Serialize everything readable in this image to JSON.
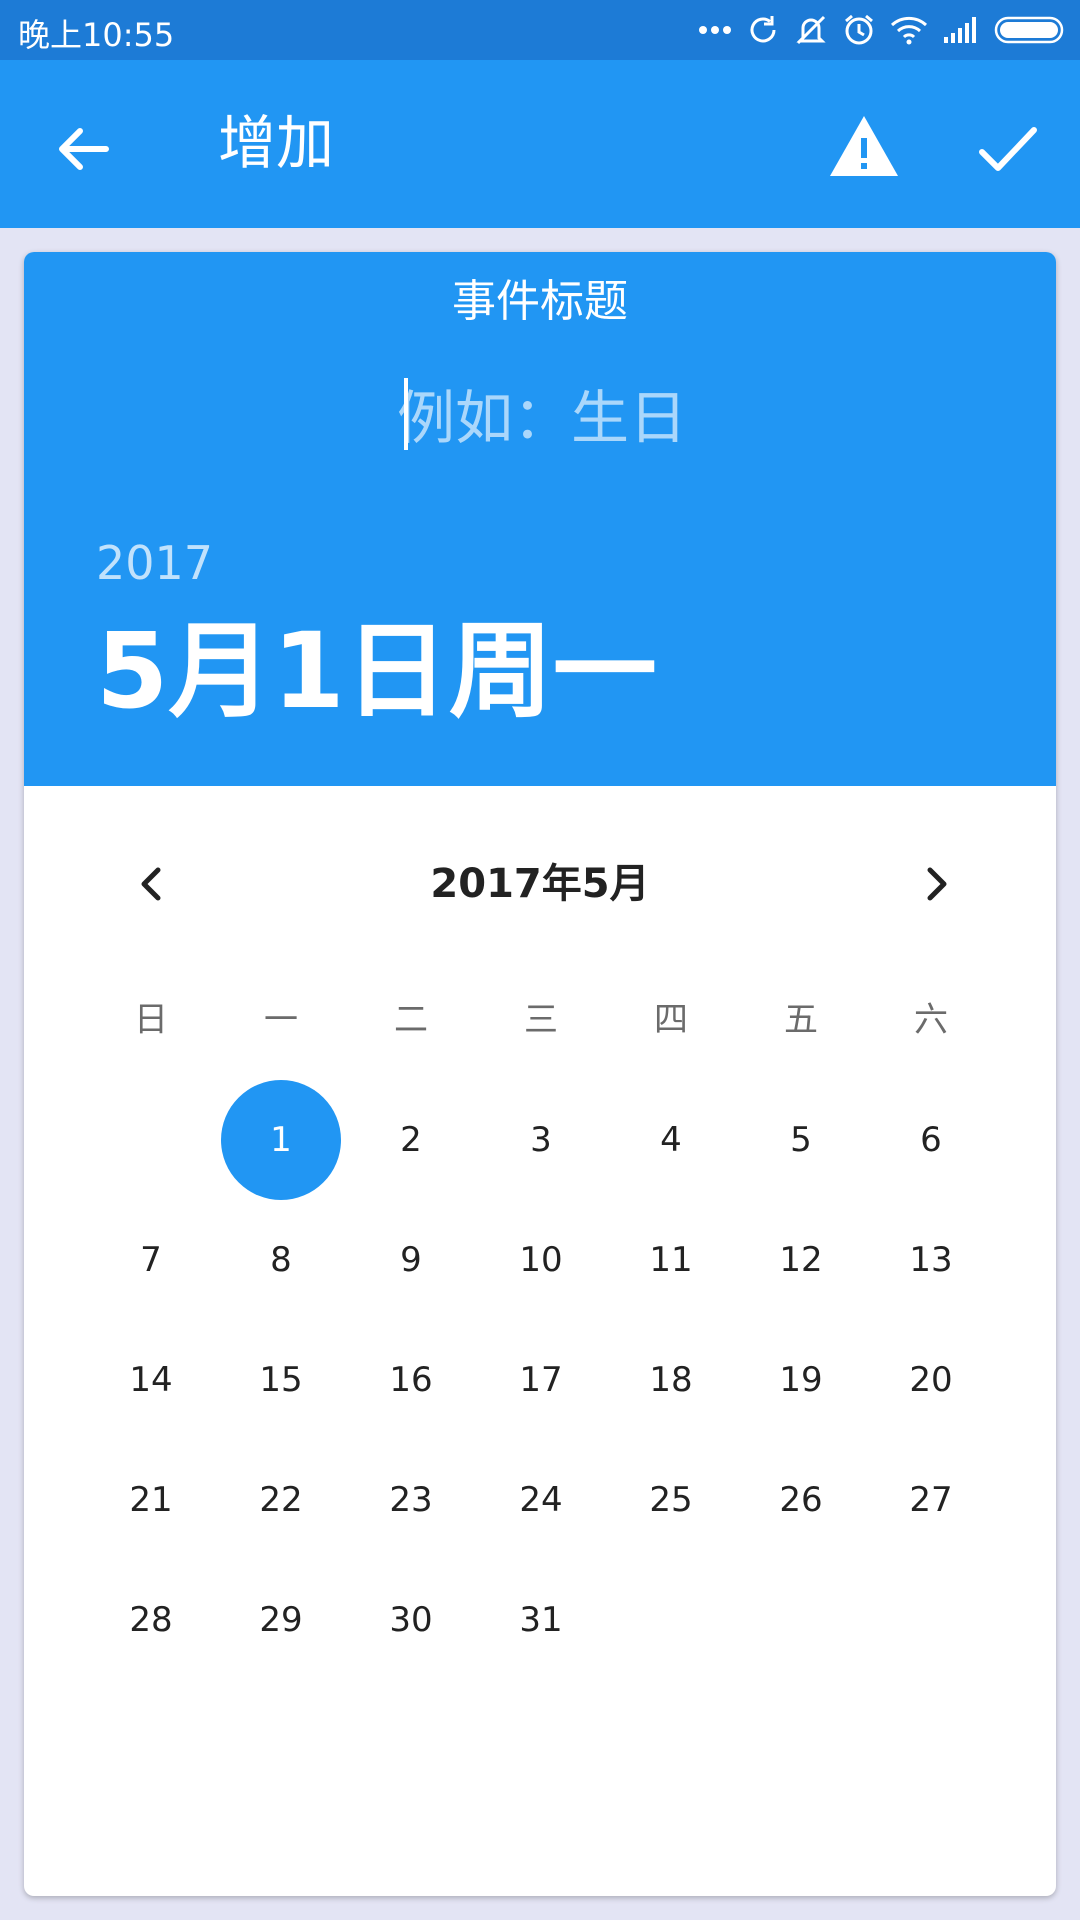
{
  "status_bar": {
    "time": "晚上10:55",
    "icons": [
      "more-dots-icon",
      "sync-icon",
      "silent-icon",
      "alarm-icon",
      "wifi-icon",
      "signal-icon",
      "battery-icon"
    ]
  },
  "app_bar": {
    "title": "增加",
    "back_icon": "arrow-left-icon",
    "warning_icon": "warning-icon",
    "confirm_icon": "check-icon"
  },
  "event": {
    "label": "事件标题",
    "placeholder": "例如：生日",
    "value": ""
  },
  "selected_date": {
    "year": "2017",
    "display": "5月1日周一"
  },
  "calendar": {
    "month_label": "2017年5月",
    "weekdays": [
      "日",
      "一",
      "二",
      "三",
      "四",
      "五",
      "六"
    ],
    "first_day_offset": 1,
    "days_in_month": 31,
    "selected_day": 1
  },
  "colors": {
    "primary": "#2196f3",
    "status_bar": "#1d7bd6",
    "background": "#e3e4f4"
  }
}
